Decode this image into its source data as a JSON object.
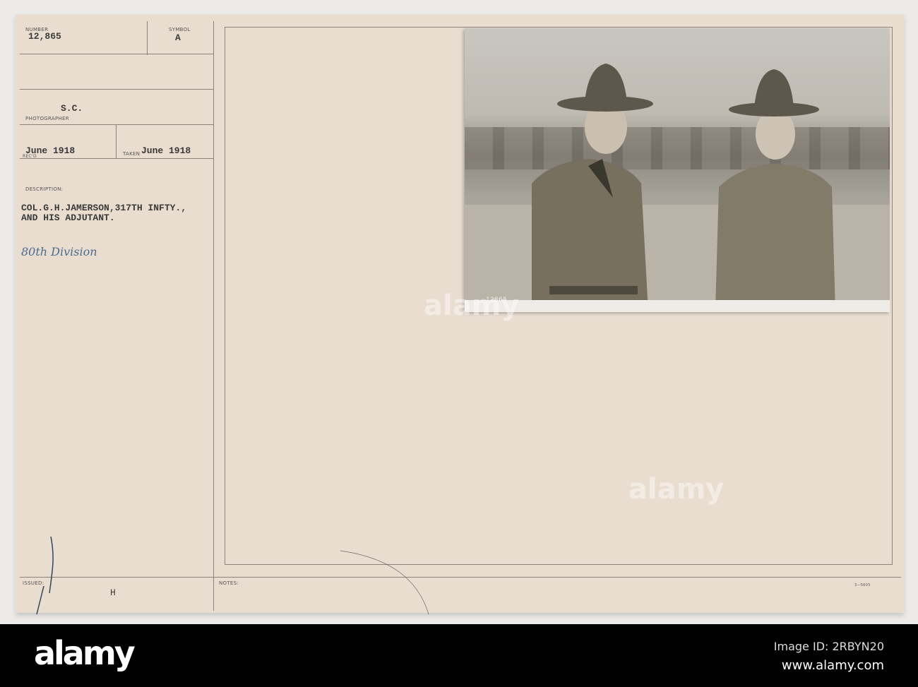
{
  "card": {
    "number_label": "NUMBER",
    "number": "12,865",
    "symbol_label": "SYMBOL",
    "symbol": "A",
    "photographer": "S.C.",
    "photographer_label": "PHOTOGRAPHER",
    "recd_label": "REC'D",
    "recd": "June 1918",
    "taken_label": "TAKEN",
    "taken": "June 1918",
    "description_label": "DESCRIPTION:",
    "description_line1": "COL.G.H.JAMERSON,317TH INFTY.,",
    "description_line2": "AND HIS ADJUTANT.",
    "handwritten": "80th Division",
    "issued_label": "ISSUED:",
    "issued": "H",
    "notes_label": "NOTES:",
    "form_number": "3—5605",
    "photo_caption": "12865"
  },
  "watermark": "alamy",
  "banner": {
    "logo": "alamy",
    "image_id": "Image ID: 2RBYN20",
    "url": "www.alamy.com"
  }
}
